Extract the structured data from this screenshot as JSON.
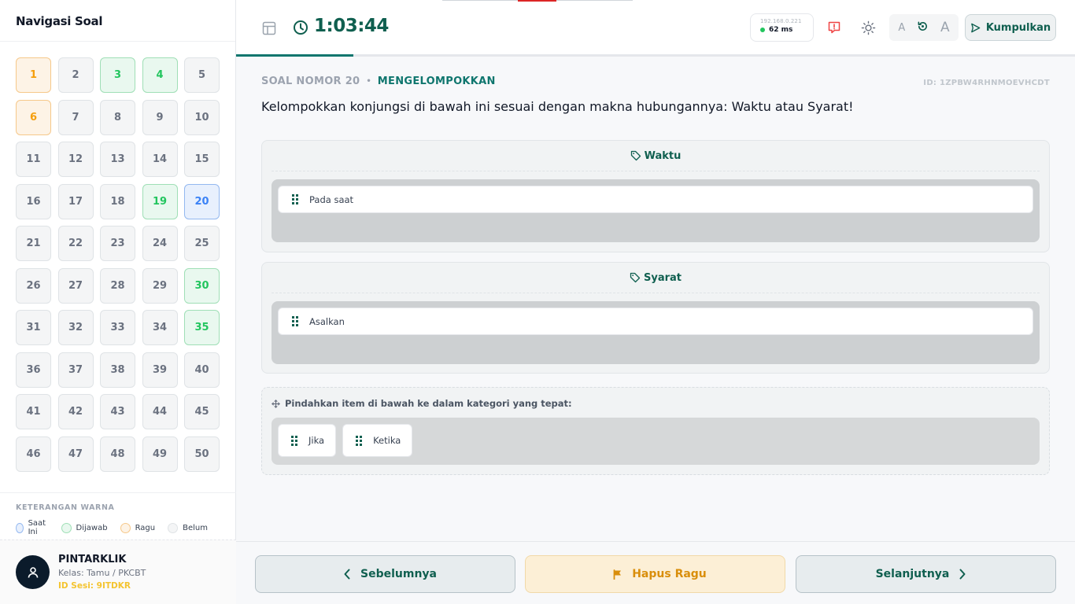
{
  "sidebar": {
    "title": "Navigasi Soal",
    "questions": [
      {
        "n": "1",
        "s": "doubt"
      },
      {
        "n": "2",
        "s": "none"
      },
      {
        "n": "3",
        "s": "answered"
      },
      {
        "n": "4",
        "s": "answered"
      },
      {
        "n": "5",
        "s": "none"
      },
      {
        "n": "6",
        "s": "doubt"
      },
      {
        "n": "7",
        "s": "none"
      },
      {
        "n": "8",
        "s": "none"
      },
      {
        "n": "9",
        "s": "none"
      },
      {
        "n": "10",
        "s": "none"
      },
      {
        "n": "11",
        "s": "none"
      },
      {
        "n": "12",
        "s": "none"
      },
      {
        "n": "13",
        "s": "none"
      },
      {
        "n": "14",
        "s": "none"
      },
      {
        "n": "15",
        "s": "none"
      },
      {
        "n": "16",
        "s": "none"
      },
      {
        "n": "17",
        "s": "none"
      },
      {
        "n": "18",
        "s": "none"
      },
      {
        "n": "19",
        "s": "answered"
      },
      {
        "n": "20",
        "s": "current"
      },
      {
        "n": "21",
        "s": "none"
      },
      {
        "n": "22",
        "s": "none"
      },
      {
        "n": "23",
        "s": "none"
      },
      {
        "n": "24",
        "s": "none"
      },
      {
        "n": "25",
        "s": "none"
      },
      {
        "n": "26",
        "s": "none"
      },
      {
        "n": "27",
        "s": "none"
      },
      {
        "n": "28",
        "s": "none"
      },
      {
        "n": "29",
        "s": "none"
      },
      {
        "n": "30",
        "s": "answered"
      },
      {
        "n": "31",
        "s": "none"
      },
      {
        "n": "32",
        "s": "none"
      },
      {
        "n": "33",
        "s": "none"
      },
      {
        "n": "34",
        "s": "none"
      },
      {
        "n": "35",
        "s": "answered"
      },
      {
        "n": "36",
        "s": "none"
      },
      {
        "n": "37",
        "s": "none"
      },
      {
        "n": "38",
        "s": "none"
      },
      {
        "n": "39",
        "s": "none"
      },
      {
        "n": "40",
        "s": "none"
      },
      {
        "n": "41",
        "s": "none"
      },
      {
        "n": "42",
        "s": "none"
      },
      {
        "n": "43",
        "s": "none"
      },
      {
        "n": "44",
        "s": "none"
      },
      {
        "n": "45",
        "s": "none"
      },
      {
        "n": "46",
        "s": "none"
      },
      {
        "n": "47",
        "s": "none"
      },
      {
        "n": "48",
        "s": "none"
      },
      {
        "n": "49",
        "s": "none"
      },
      {
        "n": "50",
        "s": "none"
      }
    ],
    "legend": {
      "title": "KETERANGAN WARNA",
      "current": "Saat Ini",
      "answered": "Dijawab",
      "doubt": "Ragu",
      "none": "Belum"
    },
    "user": {
      "name": "PINTARKLIK",
      "class": "Kelas: Tamu / PKCBT",
      "session": "ID Sesi: 9ITDKR"
    }
  },
  "topbar": {
    "timer": "1:03:44",
    "ip": "192.168.0.221",
    "ping": "62 ms",
    "font_small": "A",
    "font_large": "A",
    "submit_label": "Kumpulkan",
    "progress_fraction": 0.14
  },
  "question": {
    "number_label": "SOAL NOMOR 20",
    "separator": "•",
    "type_label": "MENGELOMPOKKAN",
    "id_label": "ID: 1ZPBW4RHNMOEVHCDT",
    "text": "Kelompokkan konjungsi di bawah ini sesuai dengan makna hubungannya: Waktu atau Syarat!"
  },
  "categories": [
    {
      "name": "Waktu",
      "items": [
        "Pada saat"
      ]
    },
    {
      "name": "Syarat",
      "items": [
        "Asalkan"
      ]
    }
  ],
  "pool": {
    "instruction": "Pindahkan item di bawah ke dalam kategori yang tepat:",
    "items": [
      "Jika",
      "Ketika"
    ]
  },
  "footer": {
    "prev_label": "Sebelumnya",
    "doubt_label": "Hapus Ragu",
    "next_label": "Selanjutnya"
  },
  "colors": {
    "primary": "#0f5f4f",
    "answered": "#22c55e",
    "doubt": "#f59e0b",
    "current": "#3b82f6"
  }
}
